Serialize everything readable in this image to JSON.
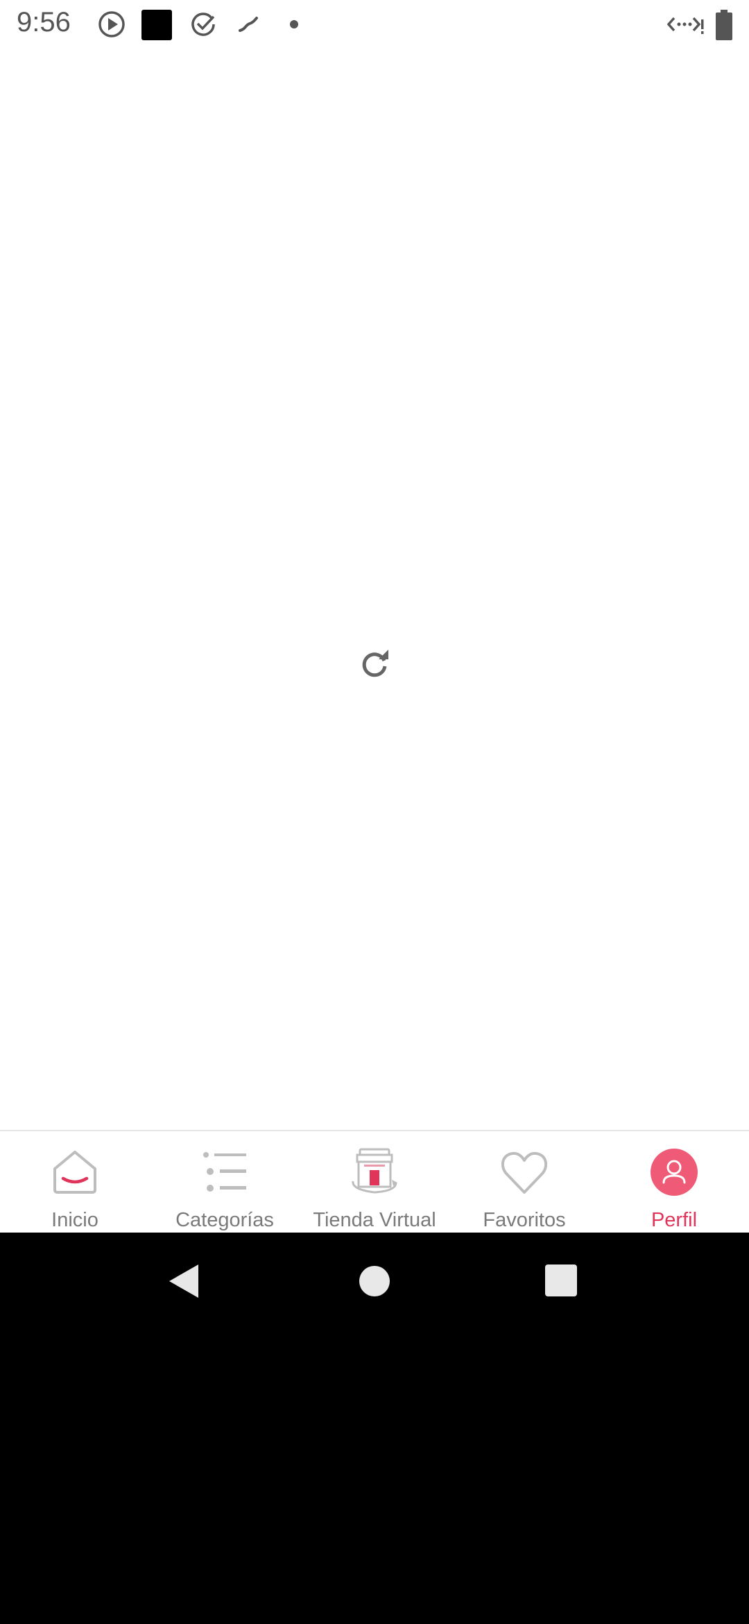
{
  "status_bar": {
    "time": "9:56",
    "icons": [
      "play-circle-icon",
      "black-square-icon",
      "check-circle-icon",
      "swipe-icon",
      "dot-icon",
      "network-code-icon",
      "battery-icon"
    ]
  },
  "content": {
    "reload_icon": "refresh-icon"
  },
  "bottom_nav": {
    "items": [
      {
        "label": "Inicio",
        "icon": "home-icon"
      },
      {
        "label": "Categorías",
        "icon": "list-icon"
      },
      {
        "label": "Tienda Virtual",
        "icon": "store-icon"
      },
      {
        "label": "Favoritos",
        "icon": "heart-icon"
      },
      {
        "label": "Perfil",
        "icon": "profile-icon"
      }
    ],
    "active_index": 4,
    "active_color": "#e0345a",
    "inactive_color": "#7a7a7a"
  },
  "system_nav": {
    "buttons": [
      "back-icon",
      "home-circle-icon",
      "recents-icon"
    ]
  }
}
